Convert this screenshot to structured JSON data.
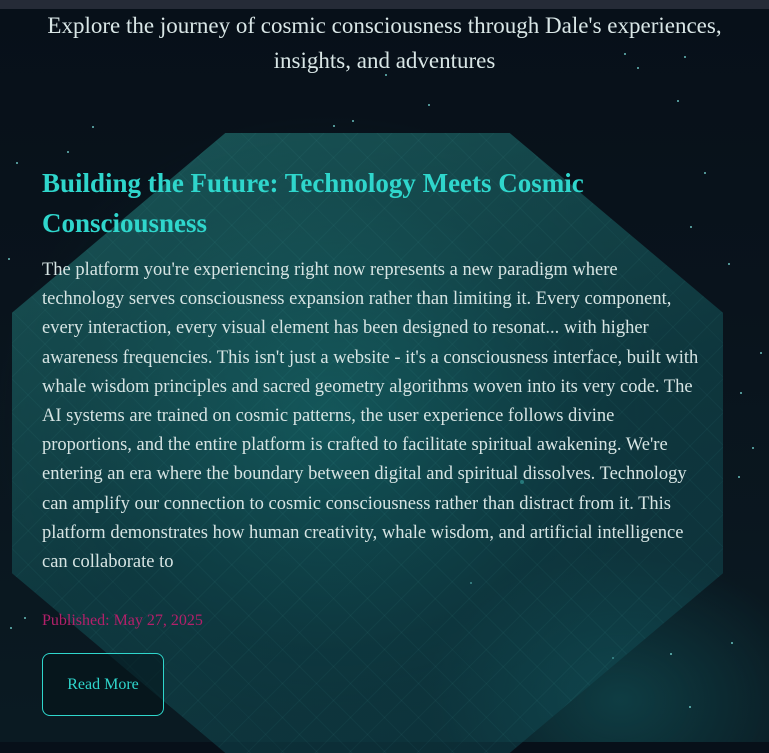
{
  "header": {
    "subtitle": "Explore the journey of cosmic consciousness through Dale's experiences, insights, and adventures"
  },
  "post": {
    "title": "Building the Future: Technology Meets Cosmic Consciousness",
    "excerpt": "The platform you're experiencing right now represents a new paradigm where technology serves consciousness expansion rather than limiting it. Every component, every interaction, every visual element has been designed to resonat... with higher awareness frequencies. This isn't just a website - it's a consciousness interface, built with whale wisdom principles and sacred geometry algorithms woven into its very code. The AI systems are trained on cosmic patterns, the user experience follows divine proportions, and the entire platform is crafted to facilitate spiritual awakening. We're entering an era where the boundary between digital and spiritual dissolves. Technology can amplify our connection to cosmic consciousness rather than distract from it. This platform demonstrates how human creativity, whale wisdom, and artificial intelligence can collaborate to",
    "published": "Published: May 27, 2025",
    "read_more_label": "Read More"
  },
  "colors": {
    "accent": "#2fd6cc",
    "published": "#b3206a",
    "background": "#071019"
  }
}
